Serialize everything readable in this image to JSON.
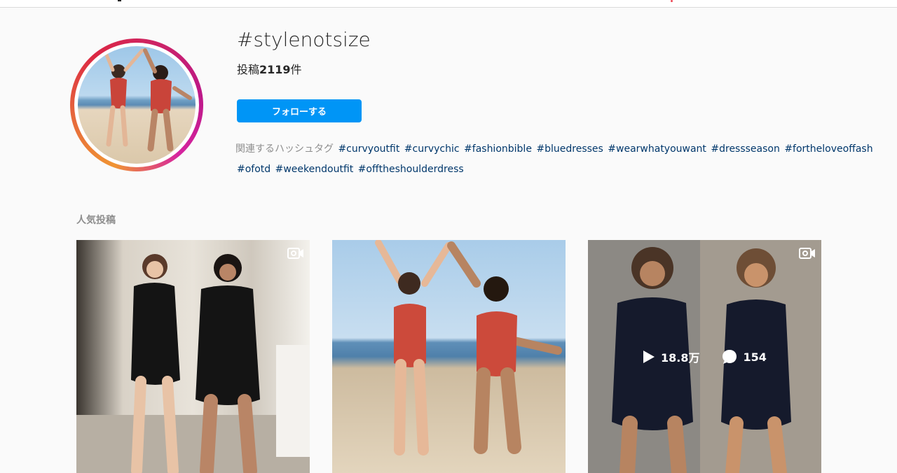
{
  "hashtag": {
    "title": "#stylenotsize",
    "post_count_prefix": "投稿",
    "post_count_value": "2119",
    "post_count_suffix": "件",
    "follow_label": "フォローする"
  },
  "related": {
    "label": "関連するハッシュタグ",
    "tags": [
      "#curvyoutfit",
      "#curvychic",
      "#fashionbible",
      "#bluedresses",
      "#wearwhatyouwant",
      "#dressseason",
      "#fortheloveoffash",
      "#ofotd",
      "#weekendoutfit",
      "#offtheshoulderdress"
    ]
  },
  "top_posts": {
    "title": "人気投稿",
    "posts": [
      {
        "type": "video"
      },
      {
        "type": "photo"
      },
      {
        "type": "video",
        "views": "18.8万",
        "comments": "154"
      }
    ]
  },
  "colors": {
    "accent": "#0095f6",
    "hashtag_link": "#00376b",
    "muted": "#8e8e8e",
    "background": "#fafafa"
  },
  "icons": {
    "video": "video-camera-icon",
    "play": "play-icon",
    "comment": "comment-bubble-icon"
  }
}
